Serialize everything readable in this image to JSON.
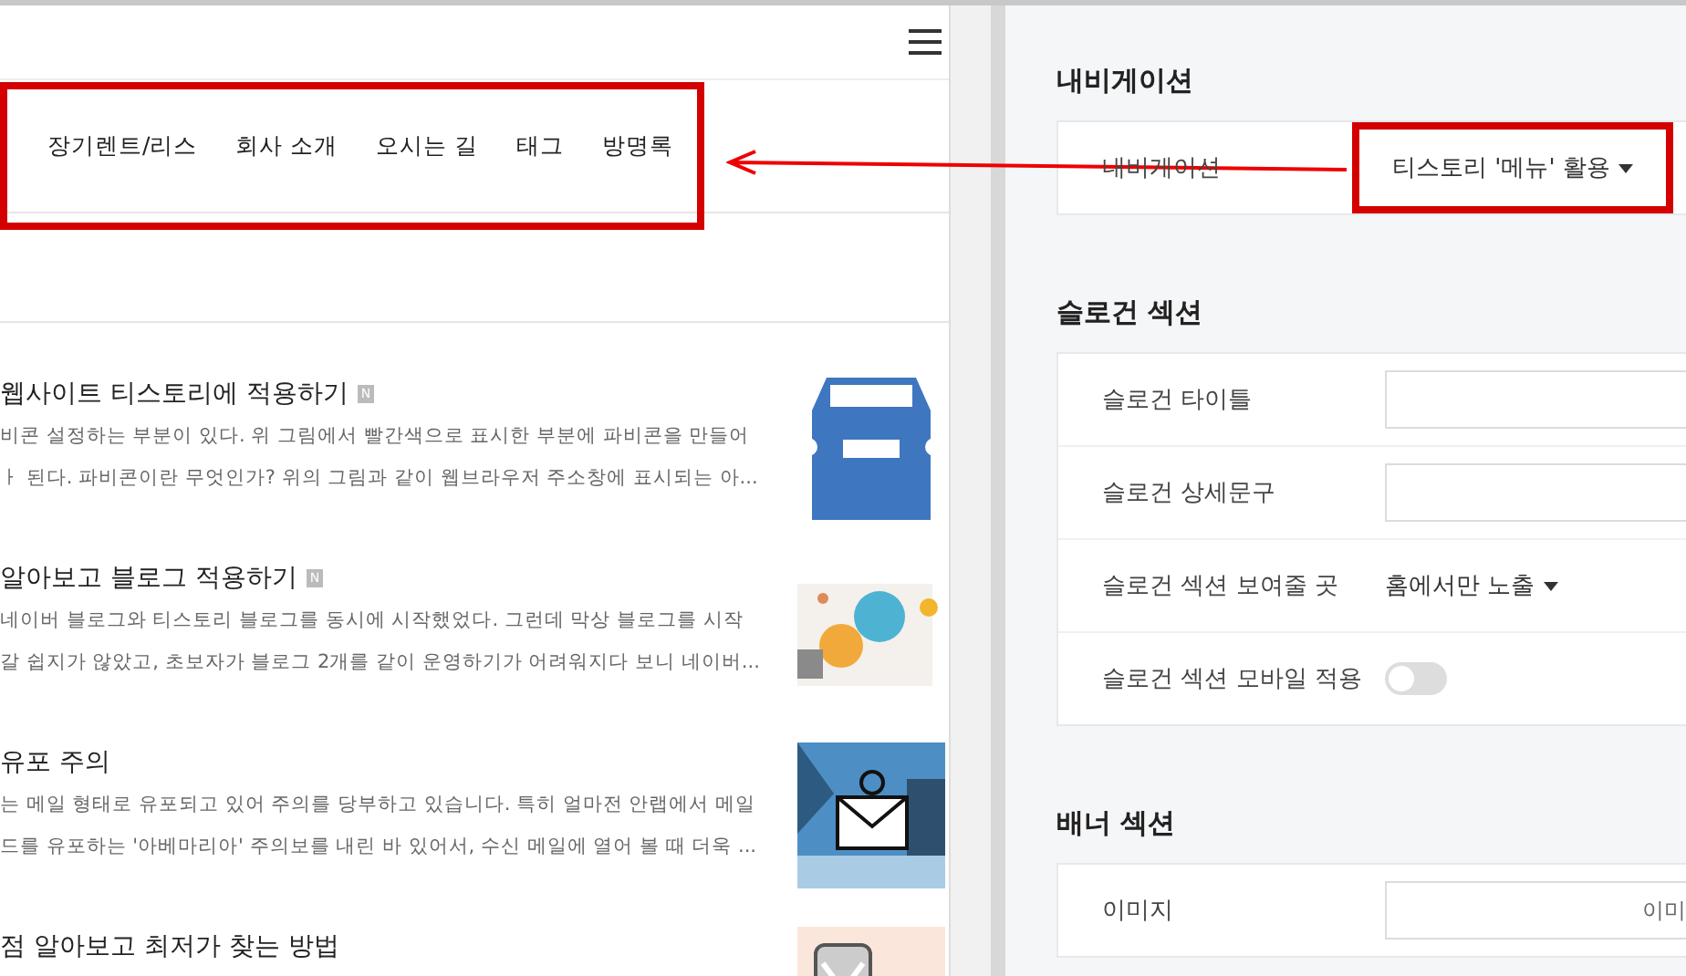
{
  "blog_preview": {
    "nav_items": [
      {
        "label": "장기렌트/리스"
      },
      {
        "label": "회사 소개"
      },
      {
        "label": "오시는 길"
      },
      {
        "label": "태그"
      },
      {
        "label": "방명록"
      }
    ],
    "posts": [
      {
        "title": "웹사이트 티스토리에 적용하기",
        "new_badge": "N",
        "excerpt_lines": [
          "비콘 설정하는 부분이 있다. 위 그림에서 빨간색으로 표시한 부분에 파비콘을 만들어",
          "ㅏ 된다. 파비콘이란 무엇인가? 위의 그림과 같이 웹브라우저 주소창에 표시되는 아..."
        ]
      },
      {
        "title": "알아보고 블로그 적용하기",
        "new_badge": "N",
        "excerpt_lines": [
          "네이버 블로그와 티스토리 블로그를 동시에 시작했었다. 그런데 막상 블로그를 시작",
          "갈 쉽지가 않았고, 초보자가 블로그 2개를 같이 운영하기가 어려워지다 보니 네이버..."
        ]
      },
      {
        "title": "유포 주의",
        "excerpt_lines": [
          "는 메일 형태로 유포되고 있어 주의를 당부하고 있습니다. 특히 얼마전 안랩에서 메일",
          "드를 유포하는 '아베마리아' 주의보를 내린 바 있어서, 수신 메일에 열어 볼 때 더욱 ..."
        ]
      },
      {
        "title": "점 알아보고 최저가 찾는 방법"
      }
    ]
  },
  "settings": {
    "sections": [
      {
        "title": "내비게이션",
        "rows": [
          {
            "kind": "select",
            "label": "내비게이션",
            "value": "티스토리 '메뉴' 활용",
            "highlighted": true
          }
        ]
      },
      {
        "title": "슬로건 섹션",
        "rows": [
          {
            "kind": "input",
            "label": "슬로건 타이틀"
          },
          {
            "kind": "input",
            "label": "슬로건 상세문구"
          },
          {
            "kind": "select",
            "label": "슬로건 섹션 보여줄 곳",
            "value": "홈에서만 노출",
            "highlighted": false
          },
          {
            "kind": "toggle",
            "label": "슬로건 섹션 모바일 적용",
            "on": false
          }
        ]
      },
      {
        "title": "배너 섹션",
        "rows": [
          {
            "kind": "input",
            "label": "이미지",
            "value": "이미"
          }
        ]
      }
    ]
  }
}
